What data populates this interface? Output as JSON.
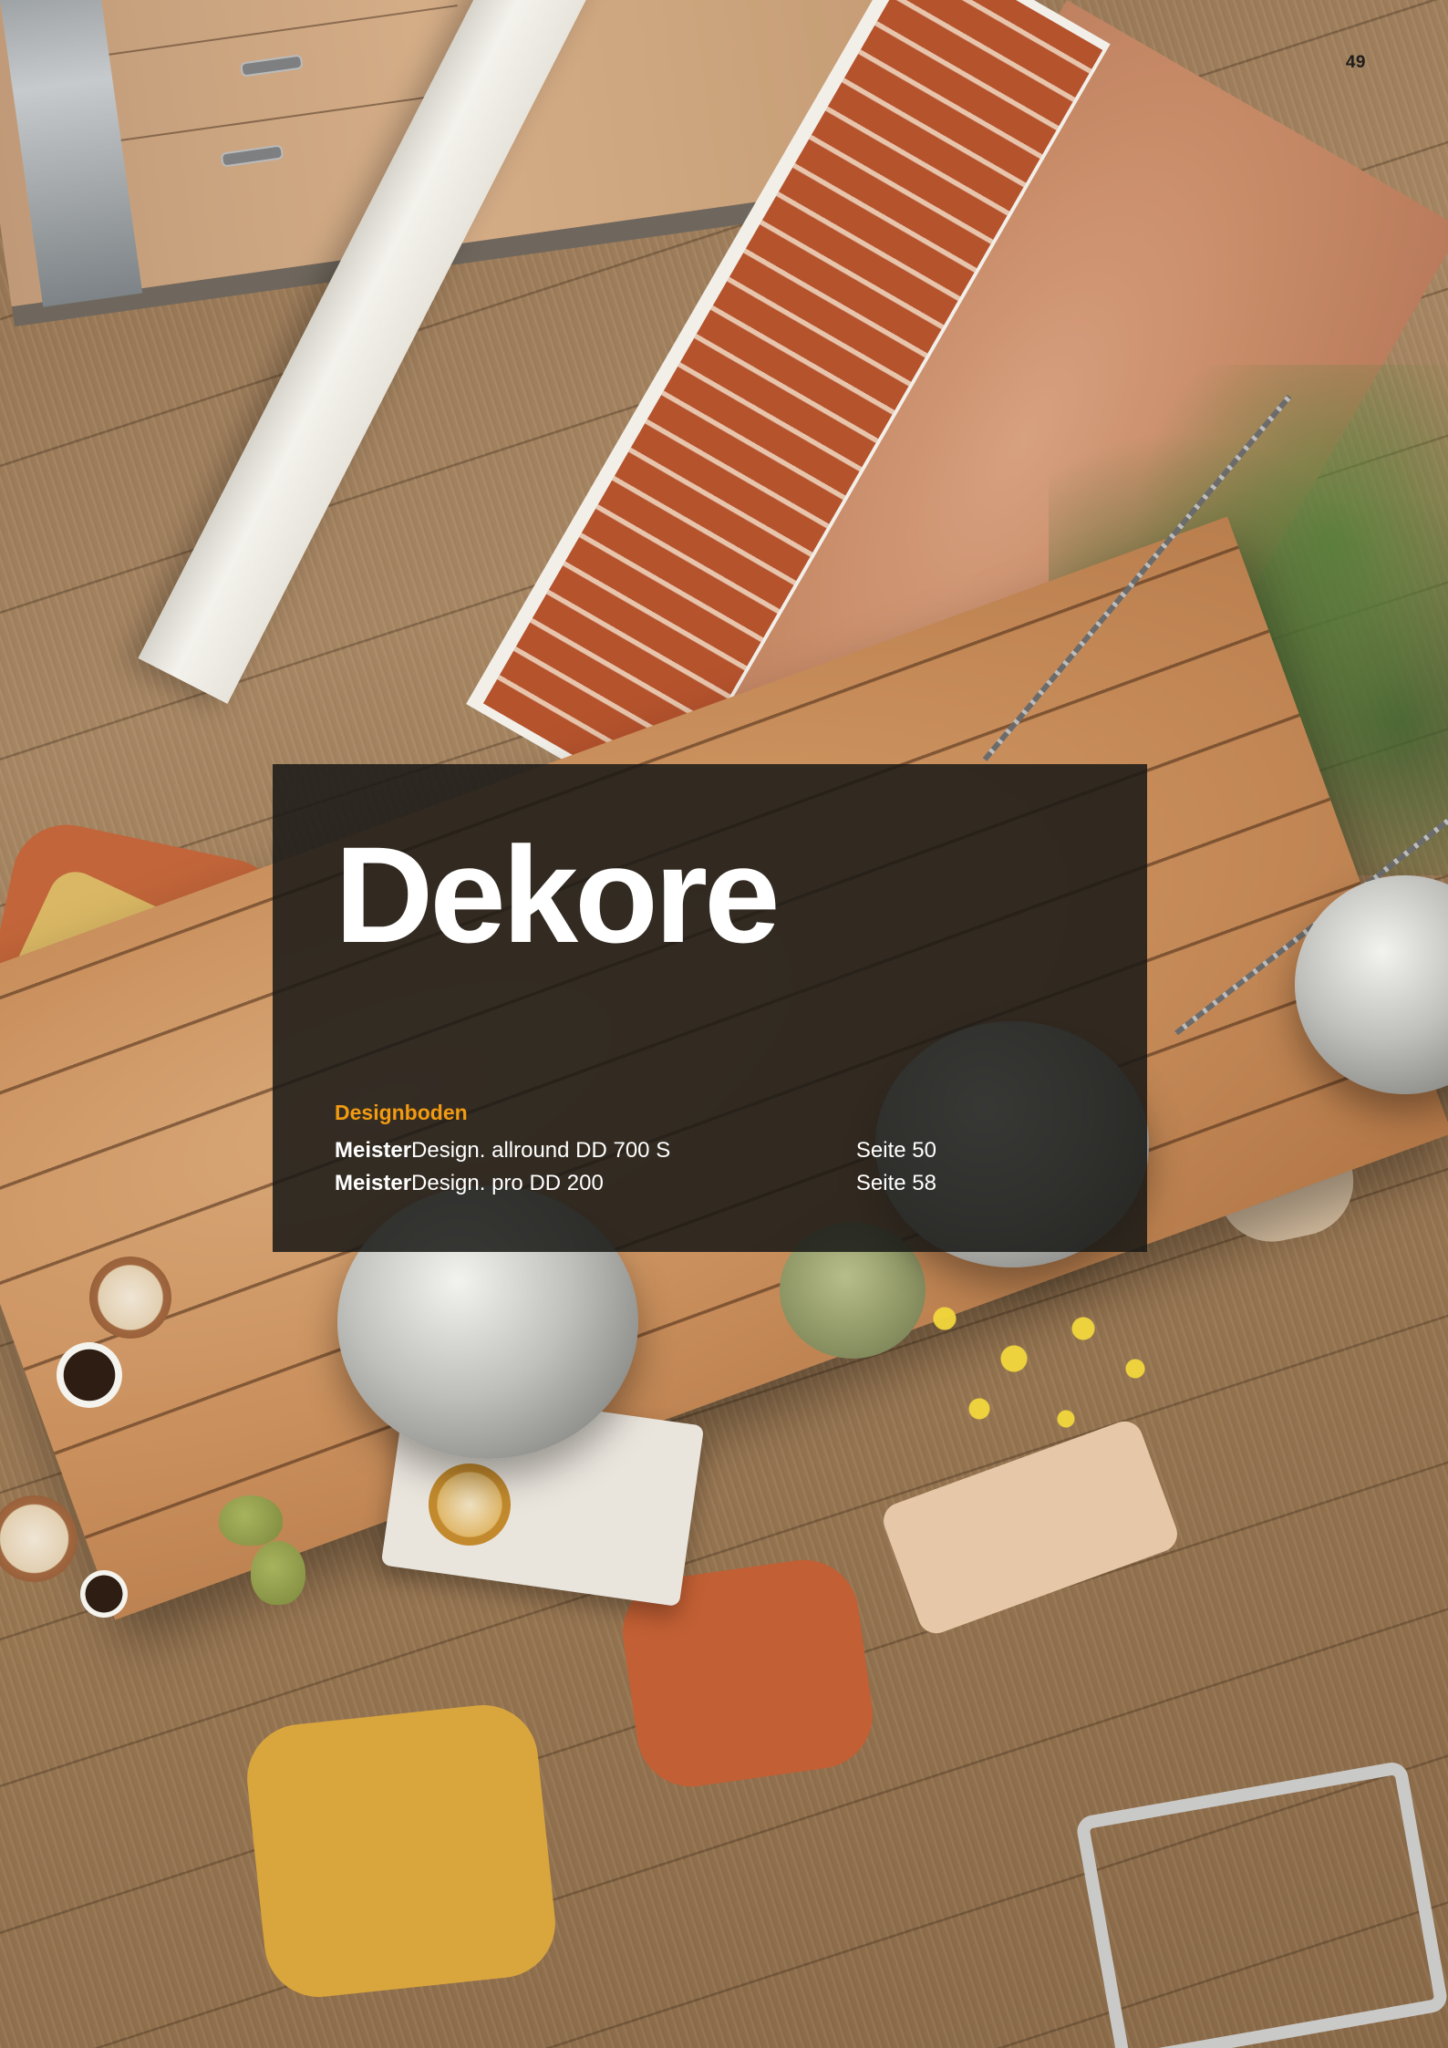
{
  "page": {
    "number": "49"
  },
  "section": {
    "title": "Dekore",
    "category": "Designboden",
    "entries": [
      {
        "brand": "Meister",
        "product": "Design. allround DD 700 S",
        "page_ref": "Seite 50"
      },
      {
        "brand": "Meister",
        "product": "Design. pro DD 200",
        "page_ref": "Seite 58"
      }
    ]
  },
  "colors": {
    "accent": "#f29a11",
    "overlay": "#181816",
    "text": "#ffffff"
  }
}
